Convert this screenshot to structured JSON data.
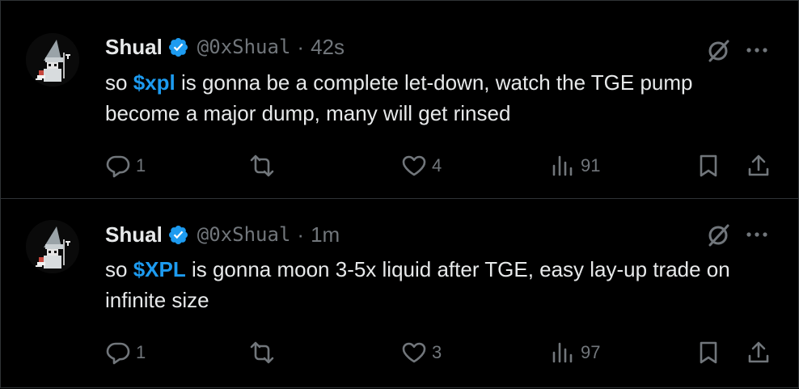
{
  "tweets": [
    {
      "author": {
        "name": "Shual",
        "handle": "@0xShual",
        "verified": true,
        "avatar_icon": "pixel-wizard-avatar"
      },
      "separator": "·",
      "time": "42s",
      "text": {
        "prefix": "so ",
        "cashtag": "$xpl",
        "suffix": " is gonna be a complete let-down, watch the TGE pump become a major dump, many will get rinsed"
      },
      "actions": {
        "replies": "1",
        "reposts": "",
        "likes": "4",
        "views": "91"
      }
    },
    {
      "author": {
        "name": "Shual",
        "handle": "@0xShual",
        "verified": true,
        "avatar_icon": "pixel-wizard-avatar"
      },
      "separator": "·",
      "time": "1m",
      "text": {
        "prefix": "so ",
        "cashtag": "$XPL",
        "suffix": " is gonna moon 3-5x liquid after TGE, easy lay-up trade on infinite size"
      },
      "actions": {
        "replies": "1",
        "reposts": "",
        "likes": "3",
        "views": "97"
      }
    }
  ],
  "colors": {
    "background": "#000000",
    "text": "#e7e9ea",
    "muted": "#71767b",
    "accent": "#1d9bf0",
    "border": "#2f3336"
  },
  "icons": [
    "verified-badge-icon",
    "grok-icon",
    "more-icon",
    "reply-icon",
    "repost-icon",
    "like-icon",
    "views-icon",
    "bookmark-icon",
    "share-icon"
  ]
}
